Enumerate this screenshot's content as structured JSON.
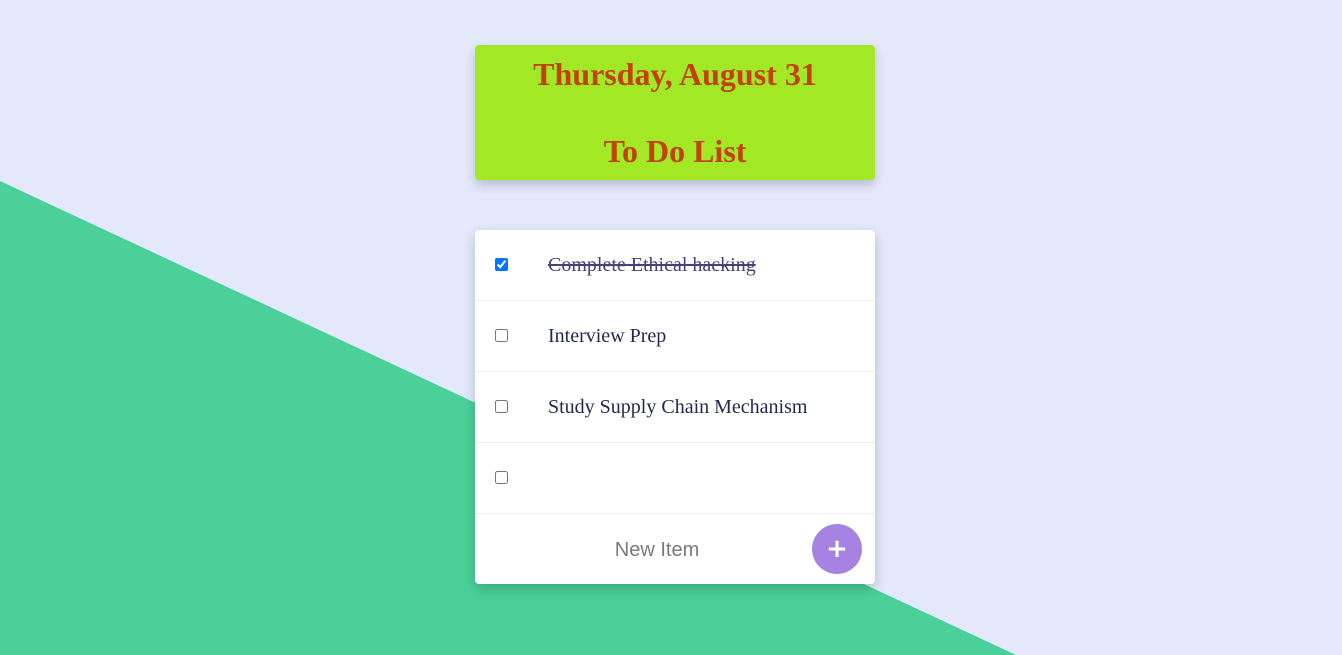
{
  "colors": {
    "background": "#E3E8FB",
    "accent_shape": "#4CD09A",
    "heading_bg": "#A3E824",
    "heading_text": "#C2410C",
    "add_button": "#A683E3"
  },
  "heading": {
    "date": "Thursday, August 31",
    "title": "To Do List"
  },
  "items": [
    {
      "label": "Complete Ethical hacking",
      "checked": true
    },
    {
      "label": "Interview Prep",
      "checked": false
    },
    {
      "label": "Study Supply Chain Mechanism",
      "checked": false
    },
    {
      "label": "",
      "checked": false
    }
  ],
  "new_item": {
    "placeholder": "New Item",
    "add_label": "+",
    "add_icon": "plus-icon"
  }
}
